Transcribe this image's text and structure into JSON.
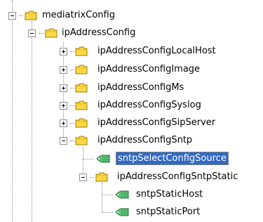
{
  "tree": {
    "root": {
      "label": "mediatrixConfig",
      "expanded": true,
      "icon": "folder-icon",
      "child": {
        "label": "ipAddressConfig",
        "expanded": true,
        "icon": "folder-icon",
        "children": [
          {
            "label": "ipAddressConfigLocalHost",
            "expanded": false,
            "icon": "folder-icon"
          },
          {
            "label": "ipAddressConfigImage",
            "expanded": false,
            "icon": "folder-icon"
          },
          {
            "label": "ipAddressConfigMs",
            "expanded": false,
            "icon": "folder-icon"
          },
          {
            "label": "ipAddressConfigSyslog",
            "expanded": false,
            "icon": "folder-icon"
          },
          {
            "label": "ipAddressConfigSipServer",
            "expanded": false,
            "icon": "folder-icon"
          },
          {
            "label": "ipAddressConfigSntp",
            "expanded": true,
            "icon": "folder-icon",
            "children": [
              {
                "label": "sntpSelectConfigSource",
                "icon": "leaf-variable-icon",
                "selected": true
              },
              {
                "label": "ipAddressConfigSntpStatic",
                "expanded": true,
                "icon": "folder-icon",
                "children": [
                  {
                    "label": "sntpStaticHost",
                    "icon": "leaf-variable-icon"
                  },
                  {
                    "label": "sntpStaticPort",
                    "icon": "leaf-variable-icon"
                  }
                ]
              }
            ]
          }
        ]
      }
    }
  },
  "colors": {
    "selection": "#316ac5",
    "folder_yellow": "#ffd84a",
    "leaf_green": "#4fb86a",
    "tree_lines": "#8c8c8c"
  }
}
